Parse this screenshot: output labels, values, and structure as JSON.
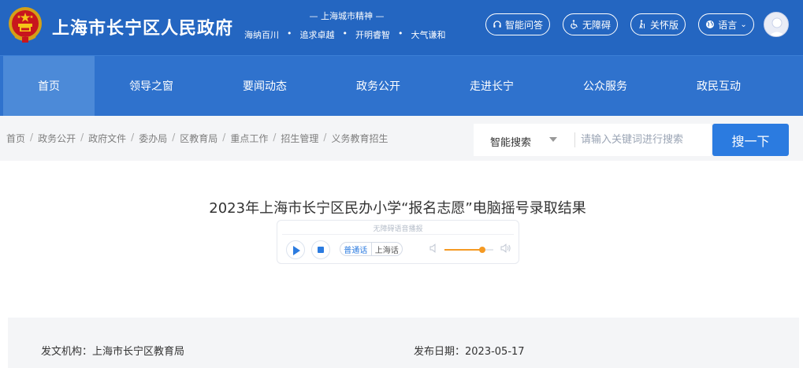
{
  "header": {
    "site_title": "上海市长宁区人民政府",
    "spirit_title": "— 上海城市精神 —",
    "spirit_items": [
      "海纳百川",
      "追求卓越",
      "开明睿智",
      "大气谦和"
    ],
    "spirit_separator": "•",
    "buttons": {
      "ai": "智能问答",
      "accessibility": "无障碍",
      "care": "关怀版",
      "language": "语言"
    },
    "colors": {
      "header_bg": "#2466c1",
      "nav_bg": "#2f72cd",
      "nav_active_bg": "#4c8ad8"
    }
  },
  "nav": {
    "items": [
      {
        "label": "首页",
        "active": true
      },
      {
        "label": "领导之窗",
        "active": false
      },
      {
        "label": "要闻动态",
        "active": false
      },
      {
        "label": "政务公开",
        "active": false
      },
      {
        "label": "走进长宁",
        "active": false
      },
      {
        "label": "公众服务",
        "active": false
      },
      {
        "label": "政民互动",
        "active": false
      }
    ]
  },
  "breadcrumb": {
    "separator": "/",
    "items": [
      "首页",
      "政务公开",
      "政府文件",
      "委办局",
      "区教育局",
      "重点工作",
      "招生管理",
      "义务教育招生"
    ]
  },
  "search": {
    "type_label": "智能搜索",
    "placeholder": "请输入关键词进行搜索",
    "button_label": "搜一下",
    "button_color": "#2b7be0"
  },
  "article": {
    "title": "2023年上海市长宁区民办小学“报名志愿”电脑摇号录取结果",
    "player": {
      "caption": "无障碍语音播报",
      "languages": [
        "普通话",
        "上海话"
      ],
      "active_language": "普通话",
      "volume": 0.78,
      "accent_color": "#f59a23"
    },
    "meta": {
      "issuer": "发文机构：上海市长宁区教育局",
      "date": "发布日期：2023-05-17"
    }
  }
}
